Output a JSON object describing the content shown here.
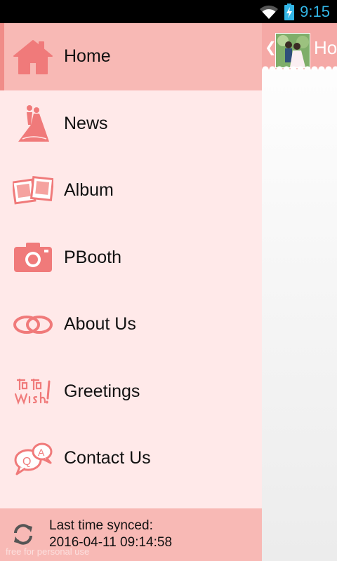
{
  "status_bar": {
    "time": "9:15"
  },
  "action_bar": {
    "title": "Ho"
  },
  "menu": {
    "items": [
      {
        "label": "Home",
        "icon": "home-icon",
        "selected": true
      },
      {
        "label": "News",
        "icon": "bride-groom-icon",
        "selected": false
      },
      {
        "label": "Album",
        "icon": "photo-album-icon",
        "selected": false
      },
      {
        "label": "PBooth",
        "icon": "camera-icon",
        "selected": false
      },
      {
        "label": "About Us",
        "icon": "wedding-rings-icon",
        "selected": false
      },
      {
        "label": "Greetings",
        "icon": "wish-greeting-icon",
        "selected": false
      },
      {
        "label": "Contact Us",
        "icon": "q-a-chat-icon",
        "selected": false
      }
    ]
  },
  "footer": {
    "sync_label": "Last time synced:",
    "sync_time": "2016-04-11 09:14:58",
    "watermark": "free for personal use"
  },
  "colors": {
    "accent_pink": "#f07a7a",
    "drawer_bg": "#ffe9e9",
    "selected_bg": "#f8b9b5",
    "clock": "#33b5e5"
  }
}
